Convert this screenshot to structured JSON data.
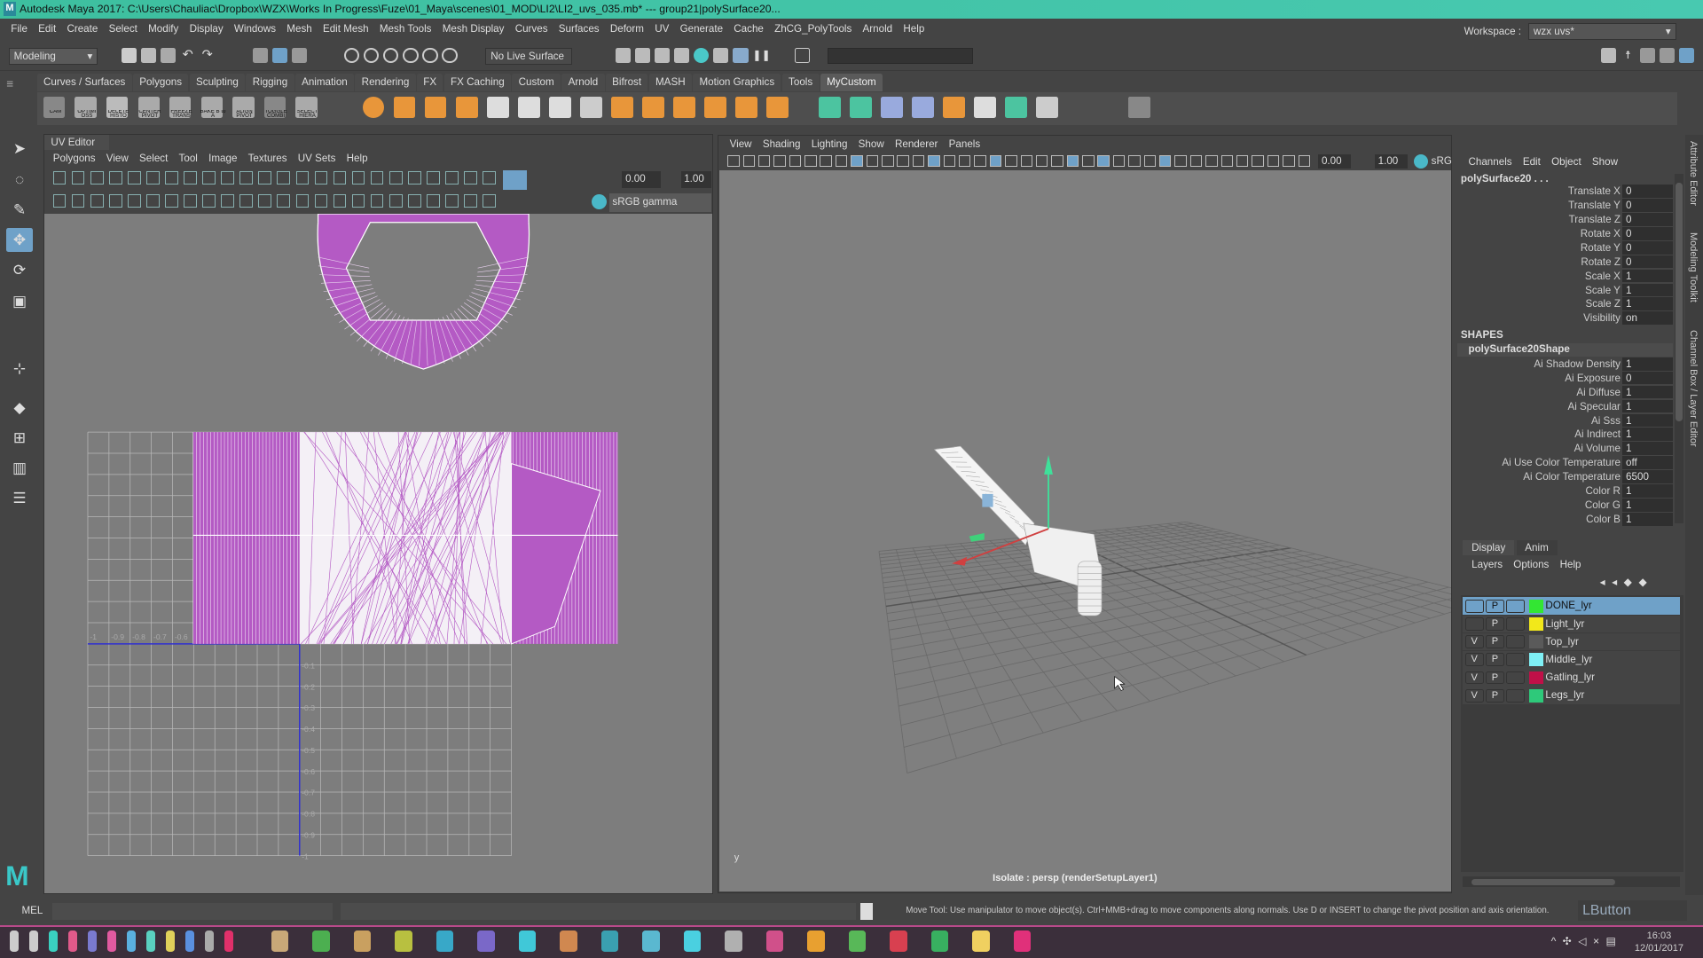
{
  "window": {
    "title": "Autodesk Maya 2017: C:\\Users\\Chauliac\\Dropbox\\WZX\\Works In Progress\\Fuze\\01_Maya\\scenes\\01_MOD\\LI2\\LI2_uvs_035.mb*   ---   group21|polySurface20...",
    "logo": "M"
  },
  "menubar": [
    "File",
    "Edit",
    "Create",
    "Select",
    "Modify",
    "Display",
    "Windows",
    "Mesh",
    "Edit Mesh",
    "Mesh Tools",
    "Mesh Display",
    "Curves",
    "Surfaces",
    "Deform",
    "UV",
    "Generate",
    "Cache",
    "ZhCG_PolyTools",
    "Arnold",
    "Help"
  ],
  "workspace": {
    "label": "Workspace :",
    "value": "wzx uvs*"
  },
  "statusline": {
    "mode": "Modeling",
    "live_surface": "No Live Surface"
  },
  "shelf": {
    "tabs": [
      "Curves / Surfaces",
      "Polygons",
      "Sculpting",
      "Rigging",
      "Animation",
      "Rendering",
      "FX",
      "FX Caching",
      "Custom",
      "Arnold",
      "Bifrost",
      "MASH",
      "Motion Graphics",
      "Tools",
      "MyCustom"
    ],
    "active": "MyCustom",
    "icons": [
      "cam-icon",
      "optimize-icon",
      "delete-history-icon",
      "center-pivot-icon",
      "freeze-transform-icon",
      "bake-pivot-icon",
      "align-pivot-icon",
      "toggle-icon",
      "select-hierarchy-icon",
      "sphere-icon",
      "cube-icon",
      "cylinder-icon",
      "diamond-icon",
      "box-icon",
      "extrude-icon",
      "bevel-icon",
      "grid-icon",
      "target-icon",
      "mirror-icon",
      "arrow-icon",
      "plate-icon",
      "pillar-icon",
      "stairs-icon",
      "eye-icon",
      "eye-icon-2",
      "move-icon",
      "transform-icon",
      "spread-icon",
      "checker-icon",
      "arnold-icon",
      "lattice-icon",
      "bend-icon",
      "tip-icon"
    ],
    "labels": [
      "CAM",
      "OPTIMI OSS",
      "DELETE HISTO",
      "CENTER PIVOT",
      "FREEZE TRANS",
      "BAKE B to A",
      "ALIGN PIVOT",
      "TOGGLE COMBI",
      "SELECT HIERA"
    ]
  },
  "toolbox": [
    "select-tool-icon",
    "lasso-tool-icon",
    "paint-select-icon",
    "move-tool-icon",
    "rotate-tool-icon",
    "scale-tool-icon",
    "manipulator-icon",
    "layout-single-icon",
    "layout-four-icon",
    "layout-two-icon",
    "outliner-icon"
  ],
  "uv_editor": {
    "title": "UV Editor",
    "menu": [
      "Polygons",
      "View",
      "Select",
      "Tool",
      "Image",
      "Textures",
      "UV Sets",
      "Help"
    ],
    "exposure": "0.00",
    "gamma": "1.00",
    "colorspace": "sRGB gamma",
    "u_ticks": [
      "-1",
      "-0.9",
      "-0.8",
      "-0.7",
      "-0.6"
    ],
    "v_ticks": [
      "-0.1",
      "-0.2",
      "-0.3",
      "-0.4",
      "-0.5",
      "-0.6",
      "-0.7",
      "-0.8",
      "-0.9",
      "-1"
    ],
    "uv_color": "#b45ac4"
  },
  "viewport": {
    "menu": [
      "View",
      "Shading",
      "Lighting",
      "Show",
      "Renderer",
      "Panels"
    ],
    "exposure": "0.00",
    "gamma": "1.00",
    "colorspace": "sRG",
    "hud": "Isolate : persp (renderSetupLayer1)",
    "axis": "y"
  },
  "channel_box": {
    "menu": [
      "Channels",
      "Edit",
      "Object",
      "Show"
    ],
    "object": "polySurface20 . . .",
    "channels": [
      [
        "Translate X",
        "0"
      ],
      [
        "Translate Y",
        "0"
      ],
      [
        "Translate Z",
        "0"
      ],
      [
        "Rotate X",
        "0"
      ],
      [
        "Rotate Y",
        "0"
      ],
      [
        "Rotate Z",
        "0"
      ],
      [
        "Scale X",
        "1"
      ],
      [
        "Scale Y",
        "1"
      ],
      [
        "Scale Z",
        "1"
      ],
      [
        "Visibility",
        "on"
      ]
    ],
    "shapes_label": "SHAPES",
    "shape": "polySurface20Shape",
    "shape_channels": [
      [
        "Ai Shadow Density",
        "1"
      ],
      [
        "Ai Exposure",
        "0"
      ],
      [
        "Ai Diffuse",
        "1"
      ],
      [
        "Ai Specular",
        "1"
      ],
      [
        "Ai Sss",
        "1"
      ],
      [
        "Ai Indirect",
        "1"
      ],
      [
        "Ai Volume",
        "1"
      ],
      [
        "Ai Use Color Temperature",
        "off"
      ],
      [
        "Ai Color Temperature",
        "6500"
      ],
      [
        "Color R",
        "1"
      ],
      [
        "Color G",
        "1"
      ],
      [
        "Color B",
        "1"
      ]
    ]
  },
  "layer_editor": {
    "tabs": [
      "Display",
      "Anim"
    ],
    "menu": [
      "Layers",
      "Options",
      "Help"
    ],
    "layers": [
      {
        "v": "",
        "p": "P",
        "name": "DONE_lyr",
        "color": "#33e633",
        "selected": true
      },
      {
        "v": "",
        "p": "P",
        "name": "Light_lyr",
        "color": "#f2e81a"
      },
      {
        "v": "V",
        "p": "P",
        "name": "Top_lyr",
        "color": "#5a5a5a"
      },
      {
        "v": "V",
        "p": "P",
        "name": "Middle_lyr",
        "color": "#7ff0f5"
      },
      {
        "v": "V",
        "p": "P",
        "name": "Gatling_lyr",
        "color": "#c01048"
      },
      {
        "v": "V",
        "p": "P",
        "name": "Legs_lyr",
        "color": "#2ec97a"
      }
    ]
  },
  "side_tabs": [
    "Attribute Editor",
    "Modeling Toolkit",
    "Channel Box / Layer Editor"
  ],
  "command_line": {
    "label": "MEL",
    "help": "Move Tool: Use manipulator to move object(s). Ctrl+MMB+drag to move components along normals. Use D or INSERT to change the pivot position and axis orientation.",
    "mouse": "LButton"
  },
  "taskbar": {
    "icons": [
      "start-icon",
      "search-icon",
      "share-icon",
      "lock-icon",
      "trash-icon",
      "c-icon",
      "power-icon",
      "network-icon",
      "star-icon",
      "search2-icon",
      "settings-icon",
      "record-icon",
      "floppy-icon",
      "chrome-icon",
      "notebook-icon",
      "app-icon",
      "photoshop-icon",
      "after-effects-icon",
      "cinema-icon",
      "c4d-icon",
      "maya-icon",
      "maya2-icon",
      "maya3-icon",
      "app2-icon",
      "acrobat-icon",
      "blender-icon",
      "evernote-icon",
      "app3-icon",
      "spotify-icon",
      "folder-icon",
      "app4-icon"
    ],
    "colors": [
      "#ccc",
      "#ccc",
      "#3ad0c0",
      "#e05a8a",
      "#7a7ad0",
      "#e05aa0",
      "#5ab0e0",
      "#5ad0c0",
      "#e0d05a",
      "#5a90e0",
      "#aaa",
      "#e0306a",
      "#c8a878",
      "#4caf50",
      "#c9a060",
      "#b8c040",
      "#38a8c8",
      "#7a68c8",
      "#40c8d8",
      "#d08850",
      "#3aa0b0",
      "#5ab8d0",
      "#4ad0e0",
      "#b0b0b0",
      "#d0508a",
      "#e8a030",
      "#58b858",
      "#d84050",
      "#38b060",
      "#f0d060",
      "#e0307a"
    ],
    "time": "16:03",
    "date": "12/01/2017"
  }
}
